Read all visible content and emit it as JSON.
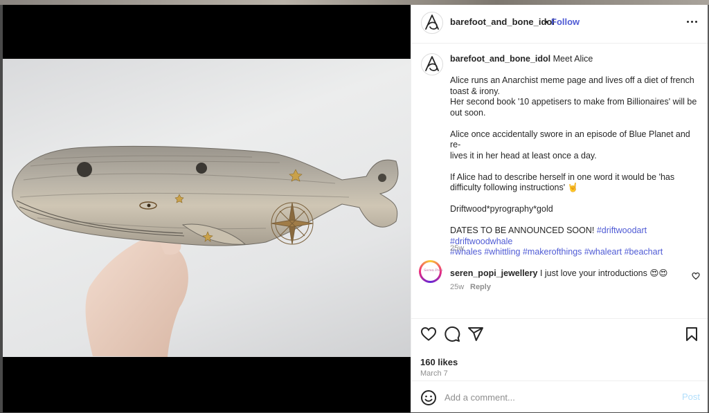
{
  "post": {
    "username": "barefoot_and_bone_idol",
    "separator": "•",
    "follow_label": "Follow",
    "caption_title": "Meet Alice",
    "caption_lines": [
      "Alice runs an Anarchist meme page and lives off a diet of french",
      "toast & irony.",
      "Her second book '10 appetisers to make from Billionaires' will be",
      "out soon.",
      "Alice once accidentally swore in an episode of Blue Planet and re-",
      "lives it in her head at least once a day.",
      "If Alice had to describe herself in one word it would be 'has",
      "difficulty following instructions' 🤘",
      "Driftwood*pyrography*gold",
      "DATES TO BE ANNOUNCED SOON!"
    ],
    "hashtags": [
      "#driftwoodart",
      "#driftwoodwhale",
      "#whales",
      "#whittling",
      "#makerofthings",
      "#whaleart",
      "#beachart"
    ],
    "caption_time": "25w",
    "likes": "160 likes",
    "date": "March 7"
  },
  "comment": {
    "username": "seren_popi_jewellery",
    "text": "I just love your introductions 😍😍",
    "time": "25w",
    "reply_label": "Reply",
    "avatar_text": "Seren Popi"
  },
  "add_comment": {
    "placeholder": "Add a comment...",
    "post_label": "Post"
  },
  "icons": {
    "more": "more-options-icon",
    "like": "heart-icon",
    "comment": "comment-icon",
    "share": "share-icon",
    "save": "bookmark-icon",
    "emoji": "emoji-icon",
    "comment_like": "small-heart-icon"
  },
  "colors": {
    "link": "#4f5bd5",
    "secondary": "#8e8e8e",
    "post_disabled": "#b2dffc",
    "border": "#efefef"
  }
}
